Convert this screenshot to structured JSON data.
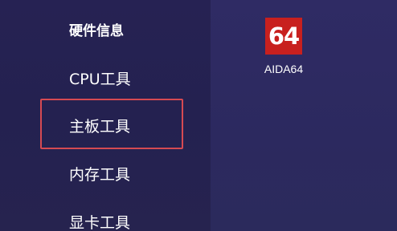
{
  "sidebar": {
    "items": [
      {
        "label": "硬件信息"
      },
      {
        "label": "CPU工具"
      },
      {
        "label": "主板工具"
      },
      {
        "label": "内存工具"
      },
      {
        "label": "显卡工具"
      }
    ],
    "highlighted_item": "主板工具",
    "highlight_color": "#d64a52"
  },
  "apps": [
    {
      "icon_text": "64",
      "label": "AIDA64",
      "icon_color": "#c8201e"
    }
  ],
  "colors": {
    "sidebar_bg": "#252252",
    "content_bg": "#2d2960",
    "text": "#ffffff"
  }
}
